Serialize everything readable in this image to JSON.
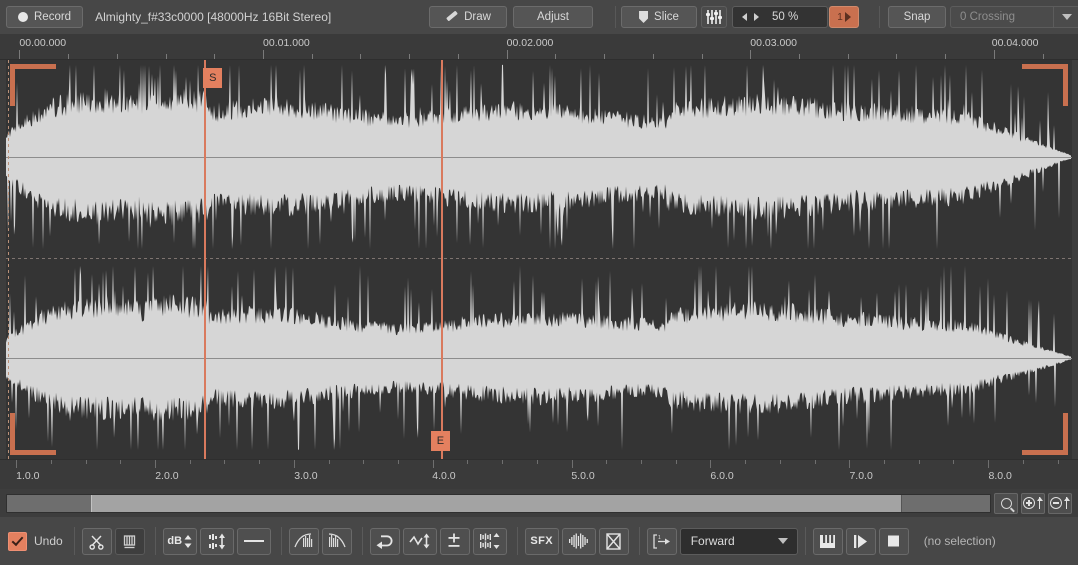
{
  "toolbar": {
    "record_label": "Record",
    "file_title": "Almighty_f#33c0000 [48000Hz 16Bit Stereo]",
    "draw_label": "Draw",
    "adjust_label": "Adjust",
    "slice_label": "Slice",
    "zoom_value": "50 %",
    "play_once_label": "1",
    "snap_label": "Snap",
    "snap_mode": "0 Crossing",
    "accent_color": "#c9704f",
    "panel_color": "#474747"
  },
  "ruler_top": {
    "labels": [
      "00.00.000",
      "00.01.000",
      "00.02.000",
      "00.03.000",
      "00.04.000"
    ],
    "positions_pct": [
      1.8,
      24.4,
      47.0,
      69.6,
      92.0
    ]
  },
  "ruler_bottom": {
    "labels": [
      "1.0.0",
      "2.0.0",
      "3.0.0",
      "4.0.0",
      "5.0.0",
      "6.0.0",
      "7.0.0",
      "8.0.0"
    ],
    "positions_pct": [
      1.5,
      14.4,
      27.3,
      40.1,
      53.0,
      65.9,
      78.8,
      91.7
    ]
  },
  "wave": {
    "start_marker_label": "S",
    "end_marker_label": "E",
    "start_marker_pct": 18.6,
    "end_marker_pct": 40.8,
    "waveform_color": "#d6d6d6",
    "background_color": "#343434",
    "marker_color": "#d97a5e",
    "channels": 2
  },
  "scrollbar": {
    "thumb_start_pct": 8.5,
    "thumb_end_pct": 91.0,
    "zoom_fit_icon": "magnifier-icon",
    "zoom_in_icon": "zoom-in-icon",
    "zoom_out_icon": "zoom-out-icon"
  },
  "bottombar": {
    "undo_label": "Undo",
    "undo_checked": true,
    "direction_value": "Forward",
    "selection_status": "(no selection)",
    "buttons": [
      {
        "name": "cut-button",
        "label": "cut-scissors-icon"
      },
      {
        "name": "crop-button",
        "label": "crop-icon"
      },
      {
        "name": "gain-db-button",
        "label": "dB"
      },
      {
        "name": "normalize-button",
        "label": "normalize-icon"
      },
      {
        "name": "silence-button",
        "label": "silence-line-icon"
      },
      {
        "name": "fade-in-button",
        "label": "fade-in-icon"
      },
      {
        "name": "fade-out-button",
        "label": "fade-out-icon"
      },
      {
        "name": "reverse-button",
        "label": "reverse-icon"
      },
      {
        "name": "pitch-bend-button",
        "label": "pitch-bend-icon"
      },
      {
        "name": "tune-button",
        "label": "plus-minus-icon"
      },
      {
        "name": "stretch-button",
        "label": "time-stretch-icon"
      },
      {
        "name": "sfx-button",
        "label": "SFX"
      },
      {
        "name": "eq-button",
        "label": "eq-icon"
      },
      {
        "name": "mute-button",
        "label": "mute-x-icon"
      },
      {
        "name": "loop-mode-button",
        "label": "loop-region-icon"
      },
      {
        "name": "keys-button",
        "label": "keys-icon"
      },
      {
        "name": "play-button",
        "label": "play-icon"
      },
      {
        "name": "stop-button",
        "label": "stop-icon"
      }
    ]
  }
}
